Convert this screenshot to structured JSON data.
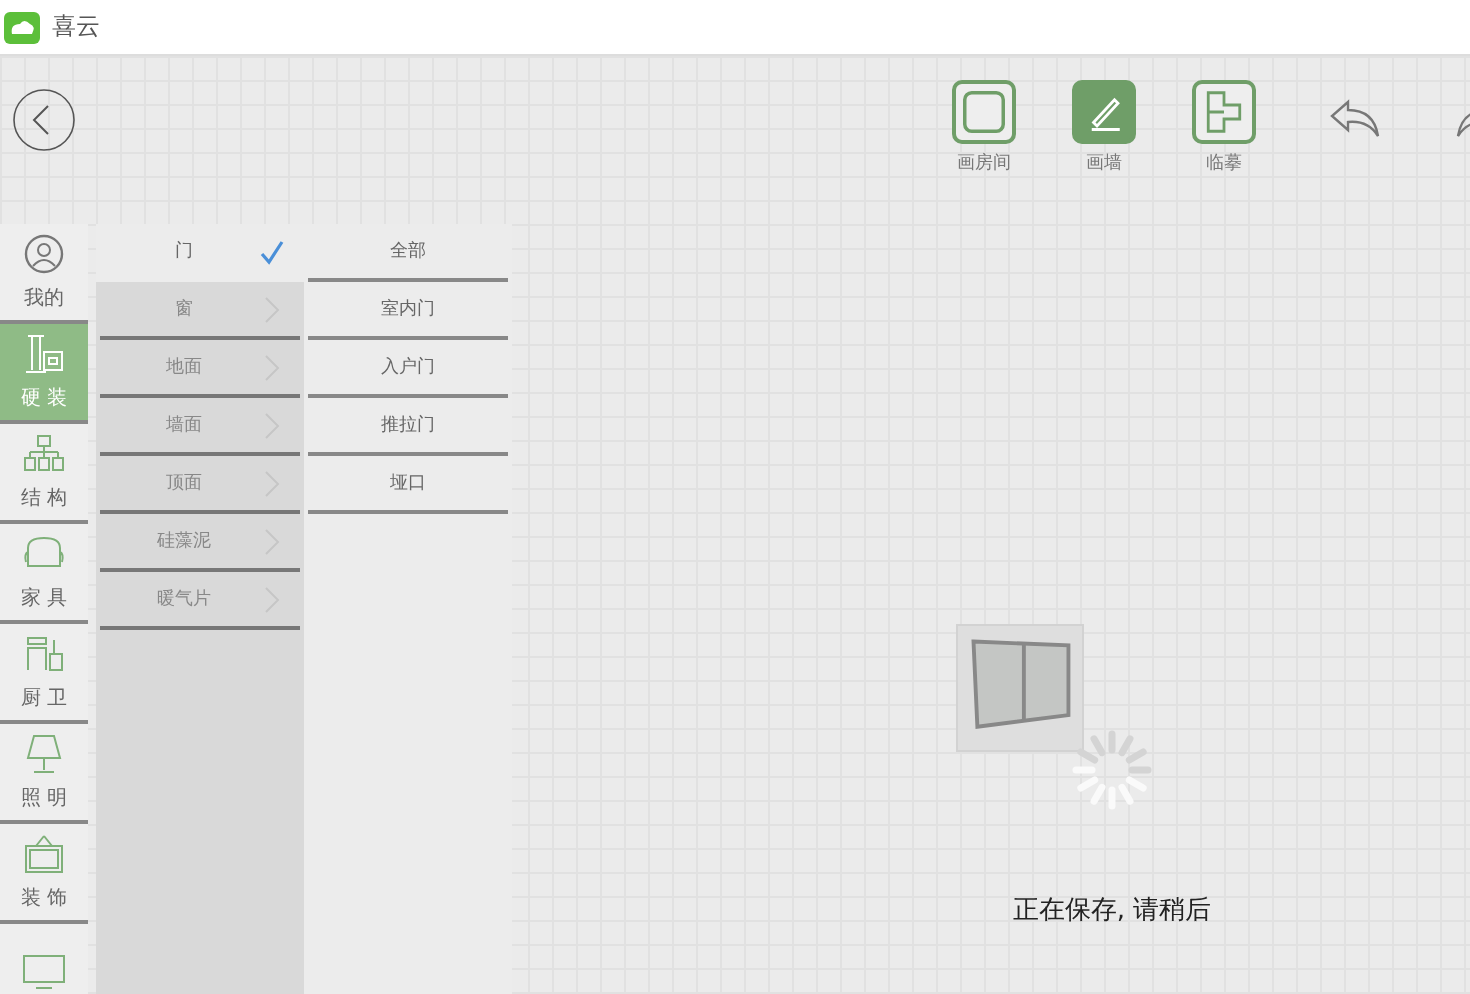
{
  "window": {
    "title": "喜云"
  },
  "toolbar": [
    {
      "label": "画房间",
      "kind": "room",
      "selected": false
    },
    {
      "label": "画墙",
      "kind": "wall",
      "selected": true
    },
    {
      "label": "临摹",
      "kind": "trace",
      "selected": false
    }
  ],
  "categories": [
    {
      "label": "我的",
      "kind": "user",
      "selected": false
    },
    {
      "label": "硬 装",
      "kind": "hard",
      "selected": true
    },
    {
      "label": "结 构",
      "kind": "structure",
      "selected": false
    },
    {
      "label": "家 具",
      "kind": "furniture",
      "selected": false
    },
    {
      "label": "厨 卫",
      "kind": "kitchen",
      "selected": false
    },
    {
      "label": "照 明",
      "kind": "lighting",
      "selected": false
    },
    {
      "label": "装 饰",
      "kind": "decor",
      "selected": false
    },
    {
      "kind": "appliance",
      "selected": false
    }
  ],
  "subcategories": [
    {
      "label": "门",
      "selected": true
    },
    {
      "label": "窗",
      "selected": false
    },
    {
      "label": "地面",
      "selected": false
    },
    {
      "label": "墙面",
      "selected": false
    },
    {
      "label": "顶面",
      "selected": false
    },
    {
      "label": "硅藻泥",
      "selected": false
    },
    {
      "label": "暖气片",
      "selected": false
    }
  ],
  "types": [
    {
      "label": "全部"
    },
    {
      "label": "室内门"
    },
    {
      "label": "入户门"
    },
    {
      "label": "推拉门"
    },
    {
      "label": "垭口"
    }
  ],
  "saving": {
    "message": "正在保存, 请稍后"
  }
}
